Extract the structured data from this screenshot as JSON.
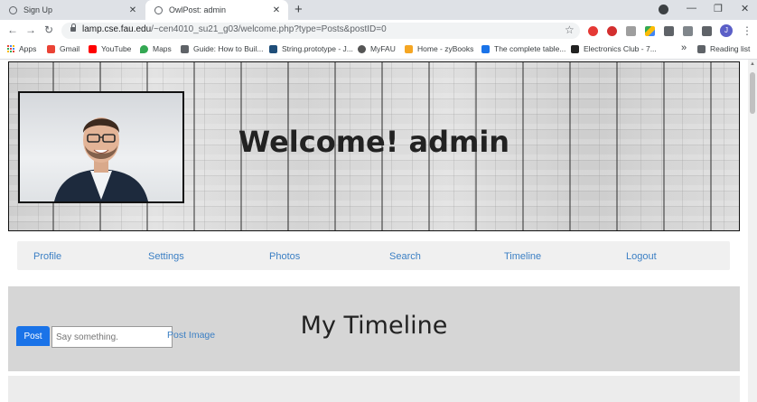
{
  "browser": {
    "tabs": [
      {
        "label": "Sign Up",
        "active": false
      },
      {
        "label": "OwlPost: admin",
        "active": true
      }
    ],
    "new_tab": "+",
    "window_controls": [
      "—",
      "❐",
      "✕"
    ],
    "nav": {
      "back": "←",
      "forward": "→",
      "reload": "↻"
    },
    "address": {
      "host": "lamp.cse.fau.edu",
      "path": "/~cen4010_su21_g03/welcome.php?type=Posts&postID=0"
    },
    "star": "☆",
    "account_initial": "J",
    "menu": "⋮",
    "bookmarks": [
      {
        "label": "Apps",
        "icon": "apps-grid-icon",
        "color": "#4285f4"
      },
      {
        "label": "Gmail",
        "icon": "gmail-icon",
        "color": "#ea4335"
      },
      {
        "label": "YouTube",
        "icon": "youtube-icon",
        "color": "#ff0000"
      },
      {
        "label": "Maps",
        "icon": "maps-pin-icon",
        "color": "#34a853"
      },
      {
        "label": "Guide: How to Buil...",
        "icon": "guide-icon",
        "color": "#5f6368"
      },
      {
        "label": "String.prototype - J...",
        "icon": "mdn-icon",
        "color": "#1f4e79"
      },
      {
        "label": "MyFAU",
        "icon": "myfau-icon",
        "color": "#555555"
      },
      {
        "label": "Home - zyBooks",
        "icon": "zybooks-icon",
        "color": "#f5a623"
      },
      {
        "label": "The complete table...",
        "icon": "bookmark-icon",
        "color": "#1a73e8"
      },
      {
        "label": "Electronics Club - 7...",
        "icon": "club-icon",
        "color": "#222222"
      }
    ],
    "more_bookmarks": "»",
    "reading_list": "Reading list"
  },
  "page": {
    "welcome_title": "Welcome! admin",
    "nav_links": [
      "Profile",
      "Settings",
      "Photos",
      "Search",
      "Timeline",
      "Logout"
    ],
    "timeline_heading": "My Timeline",
    "post_button": "Post",
    "post_placeholder": "Say something.",
    "post_image_link": "Post Image"
  },
  "colors": {
    "link": "#3b7fc4",
    "post_button": "#1a73e8",
    "timeline_band": "#d6d6d6",
    "navbar": "#f0f0f0"
  }
}
